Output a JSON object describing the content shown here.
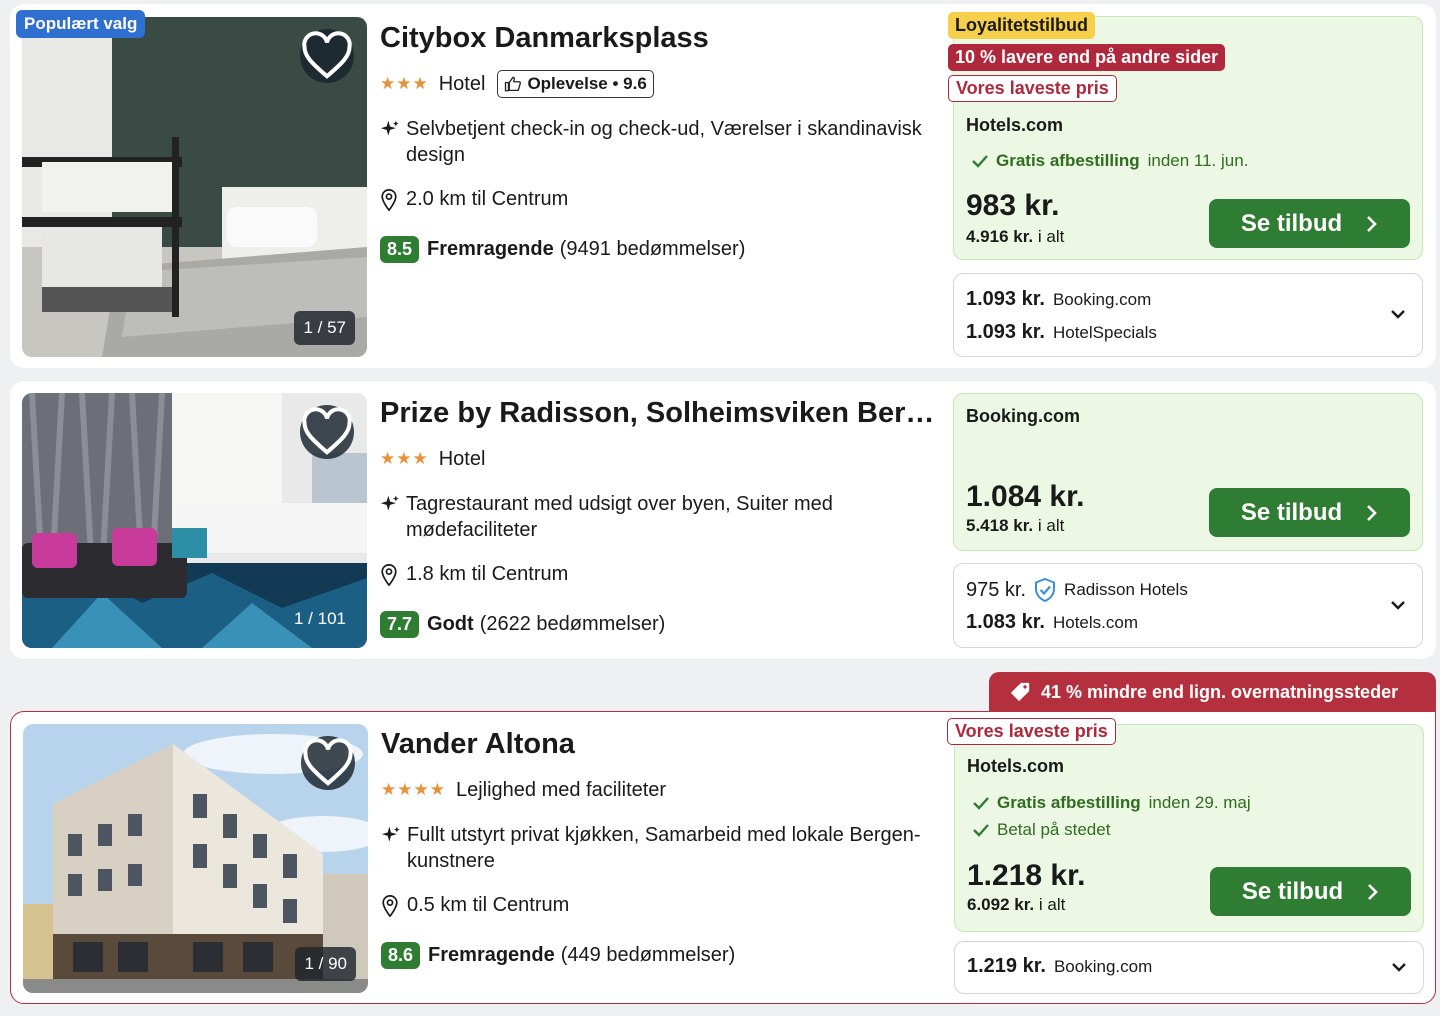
{
  "hotels": [
    {
      "badge": "Populært valg",
      "name": "Citybox Danmarksplass",
      "stars": "★★★",
      "type": "Hotel",
      "experience": "Oplevelse • 9.6",
      "features": "Selvbetjent check-in og check-ud, Værelser i skandinavisk design",
      "distance": "2.0 km til Centrum",
      "score": "8.5",
      "score_word": "Fremragende",
      "reviews": "(9491 bedømmelser)",
      "photo_counter": "1 / 57",
      "tags": {
        "loyalty": "Loyalitetstilbud",
        "discount": "10 % lavere end på andre sider",
        "lowest": "Vores laveste pris"
      },
      "offer": {
        "provider": "Hotels.com",
        "checks": [
          {
            "bold": "Gratis afbestilling",
            "rest": "inden 11. jun."
          }
        ],
        "price": "983 kr.",
        "total_bold": "4.916 kr.",
        "total_rest": "i alt",
        "cta": "Se tilbud"
      },
      "alternatives": [
        {
          "price": "1.093 kr.",
          "name": "Booking.com"
        },
        {
          "price": "1.093 kr.",
          "name": "HotelSpecials"
        }
      ]
    },
    {
      "name": "Prize by Radisson, Solheimsviken Bergen",
      "stars": "★★★",
      "type": "Hotel",
      "features": "Tagrestaurant med udsigt over byen, Suiter med mødefaciliteter",
      "distance": "1.8 km til Centrum",
      "score": "7.7",
      "score_word": "Godt",
      "reviews": "(2622 bedømmelser)",
      "photo_counter": "1 / 101",
      "offer": {
        "provider": "Booking.com",
        "price": "1.084 kr.",
        "total_bold": "5.418 kr.",
        "total_rest": "i alt",
        "cta": "Se tilbud"
      },
      "alternatives": [
        {
          "price": "975 kr.",
          "name": "Radisson Hotels",
          "verified": true
        },
        {
          "price": "1.083 kr.",
          "name": "Hotels.com"
        }
      ]
    },
    {
      "savings_banner": "41 % mindre end lign. overnatningssteder",
      "name": "Vander Altona",
      "stars": "★★★★",
      "type": "Lejlighed med faciliteter",
      "features": "Fullt utstyrt privat kjøkken, Samarbeid med lokale Bergen-kunstnere",
      "distance": "0.5 km til Centrum",
      "score": "8.6",
      "score_word": "Fremragende",
      "reviews": "(449 bedømmelser)",
      "photo_counter": "1 / 90",
      "tags": {
        "lowest": "Vores laveste pris"
      },
      "offer": {
        "provider": "Hotels.com",
        "checks": [
          {
            "bold": "Gratis afbestilling",
            "rest": "inden 29. maj"
          },
          {
            "bold": "",
            "rest": "Betal på stedet"
          }
        ],
        "price": "1.218 kr.",
        "total_bold": "6.092 kr.",
        "total_rest": "i alt",
        "cta": "Se tilbud"
      },
      "alternatives": [
        {
          "price": "1.219 kr.",
          "name": "Booking.com"
        }
      ]
    }
  ],
  "icons": {
    "favorite": "heart-icon",
    "feature": "sparkle-icon",
    "location": "pin-icon",
    "expand": "chevron-down-icon",
    "cta_arrow": "chevron-right-icon",
    "check": "check-icon",
    "thumb": "thumbs-up-icon",
    "verified": "shield-check-icon",
    "tag": "price-tag-icon"
  },
  "colors": {
    "accent_green": "#2f7d32",
    "offer_bg": "#ecf7e4",
    "deal_red": "#b0283c",
    "loyalty_yellow": "#f6d04a",
    "popular_blue": "#2e6fd0",
    "stars": "#e8913a"
  }
}
